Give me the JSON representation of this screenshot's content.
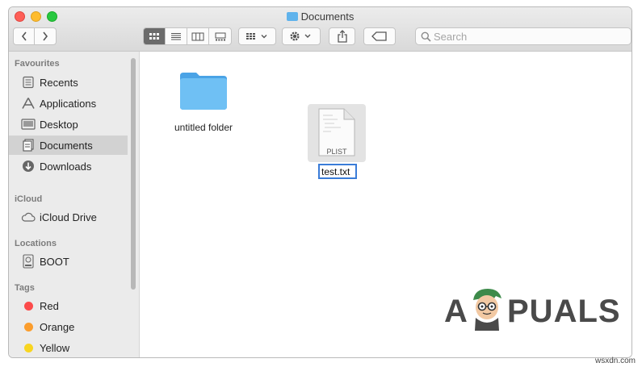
{
  "window": {
    "title": "Documents"
  },
  "toolbar": {
    "back_label": "‹",
    "forward_label": "›",
    "search_placeholder": "Search"
  },
  "sidebar": {
    "sections": [
      {
        "heading": "Favourites",
        "items": [
          {
            "label": "Recents",
            "icon": "clock-list-icon"
          },
          {
            "label": "Applications",
            "icon": "applications-icon"
          },
          {
            "label": "Desktop",
            "icon": "desktop-icon"
          },
          {
            "label": "Documents",
            "icon": "documents-icon",
            "active": true
          },
          {
            "label": "Downloads",
            "icon": "download-icon"
          }
        ]
      },
      {
        "heading": "iCloud",
        "items": [
          {
            "label": "iCloud Drive",
            "icon": "cloud-icon"
          }
        ]
      },
      {
        "heading": "Locations",
        "items": [
          {
            "label": "BOOT",
            "icon": "disk-icon"
          }
        ]
      },
      {
        "heading": "Tags",
        "items": [
          {
            "label": "Red",
            "color": "#fc4b4b"
          },
          {
            "label": "Orange",
            "color": "#fb9d2d"
          },
          {
            "label": "Yellow",
            "color": "#f8d520"
          }
        ]
      }
    ]
  },
  "files": [
    {
      "name": "untitled folder",
      "type": "folder"
    },
    {
      "name": "test.txt",
      "type": "document",
      "badge": "PLIST",
      "renaming": true
    }
  ],
  "watermark": {
    "text_left": "A",
    "text_right": "PUALS",
    "site": "wsxdn.com"
  }
}
